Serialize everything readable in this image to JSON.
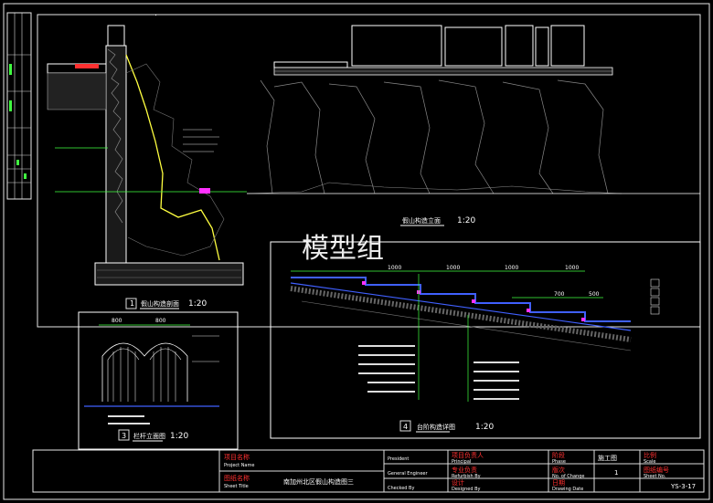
{
  "watermark": "模型组",
  "drawing_titles": {
    "rockery_elevation": "假山构造立面",
    "rockery_elevation_scale": "1:20",
    "detail1_num": "1",
    "detail1_title": "假山构造剖面",
    "detail1_scale": "1:20",
    "detail3_num": "3",
    "detail3_title": "栏杆立面图",
    "detail3_scale": "1:20",
    "detail4_num": "4",
    "detail4_title": "台阶构造详图",
    "detail4_scale": "1:20"
  },
  "dimensions": {
    "steps": [
      "1000",
      "1000",
      "1000",
      "1000",
      "700",
      "500"
    ],
    "railing": [
      "800",
      "800"
    ]
  },
  "title_block": {
    "project_label_cn": "项目名称",
    "project_label_en": "Project Name",
    "sheet_title_cn": "图纸名称",
    "sheet_title_en": "Sheet Title",
    "sheet_title_value": "南加州北区假山构造图三",
    "president": "President",
    "general_engineer": "General Engineer",
    "checked_by": "Checked By",
    "principal_cn": "项目负责人",
    "principal_en": "Principal",
    "refurbish_cn": "专业负责",
    "refurbish_en": "Refurbish By",
    "designed_cn": "设计",
    "designed_en": "Designed By",
    "phase_cn": "阶段",
    "phase_en": "Phase",
    "phase_value": "施工图",
    "change_cn": "版次",
    "change_en": "No. of Change",
    "change_value": "1",
    "date_cn": "日期",
    "date_en": "Drawing Date",
    "scale_cn": "比例",
    "scale_en": "Scale",
    "sheet_no_cn": "图纸编号",
    "sheet_no_en": "Sheet No.",
    "sheet_no_value": "YS-3-17"
  }
}
